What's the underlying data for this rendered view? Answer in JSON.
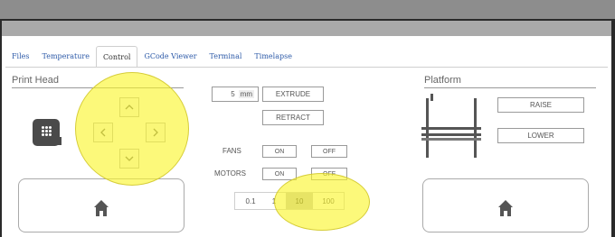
{
  "tabs": [
    {
      "label": "Files"
    },
    {
      "label": "Temperature"
    },
    {
      "label": "Control"
    },
    {
      "label": "GCode Viewer"
    },
    {
      "label": "Terminal"
    },
    {
      "label": "Timelapse"
    }
  ],
  "active_tab": "Control",
  "print_head": {
    "title": "Print Head",
    "jog_icons": [
      "chevron-up-icon",
      "chevron-left-icon",
      "chevron-right-icon",
      "chevron-down-icon"
    ],
    "home_icon": "home-icon"
  },
  "extruder": {
    "amount_value": "5",
    "unit": "mm",
    "extrude_label": "EXTRUDE",
    "retract_label": "RETRACT"
  },
  "fans": {
    "label": "FANS",
    "on_label": "ON",
    "off_label": "OFF"
  },
  "motors": {
    "label": "MOTORS",
    "on_label": "ON",
    "off_label": "OFF"
  },
  "step_sizes": [
    "0.1",
    "1",
    "10",
    "100"
  ],
  "selected_step": "10",
  "platform": {
    "title": "Platform",
    "raise_label": "RAISE",
    "lower_label": "LOWER",
    "home_icon": "home-icon"
  },
  "colors": {
    "highlight": "#faf528",
    "tab_link": "#2d5aa8",
    "icon": "#4a4a4a"
  }
}
